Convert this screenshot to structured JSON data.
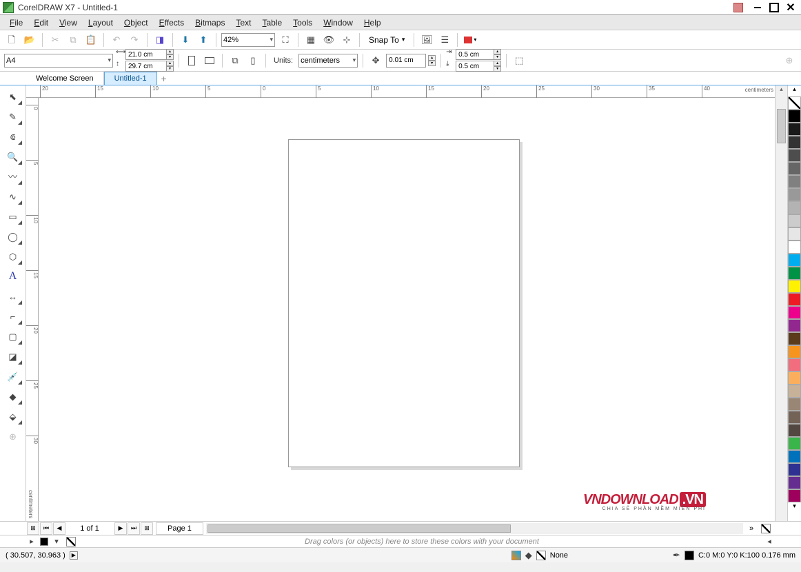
{
  "title": "CorelDRAW X7 - Untitled-1",
  "menu": [
    "File",
    "Edit",
    "View",
    "Layout",
    "Object",
    "Effects",
    "Bitmaps",
    "Text",
    "Table",
    "Tools",
    "Window",
    "Help"
  ],
  "zoom": "42%",
  "snap": "Snap To",
  "page_size": "A4",
  "dims": {
    "w": "21.0 cm",
    "h": "29.7 cm"
  },
  "units_label": "Units:",
  "units": "centimeters",
  "nudge": "0.01 cm",
  "dup": {
    "x": "0.5 cm",
    "y": "0.5 cm"
  },
  "tabs": [
    "Welcome Screen",
    "Untitled-1"
  ],
  "ruler_unit": "centimeters",
  "hruler_ticks": [
    -20,
    -15,
    -10,
    -5,
    0,
    5,
    10,
    15,
    20,
    25,
    30,
    35,
    40
  ],
  "vruler_ticks": [
    0,
    5,
    10,
    15,
    20,
    25,
    30
  ],
  "palette": [
    "#000000",
    "#1a1a1a",
    "#333333",
    "#4d4d4d",
    "#666666",
    "#808080",
    "#999999",
    "#b3b3b3",
    "#cccccc",
    "#e6e6e6",
    "#ffffff",
    "#00aeef",
    "#009245",
    "#fff200",
    "#ed1c24",
    "#ec008c",
    "#92278f",
    "#5a3b1c",
    "#f7941d",
    "#f26d7d",
    "#fbaf5d",
    "#c7b299",
    "#998675",
    "#736357",
    "#534741",
    "#39b54a",
    "#0072bc",
    "#2e3192",
    "#662d91",
    "#9e005d"
  ],
  "page_nav": {
    "current": "1 of 1",
    "tab": "Page 1"
  },
  "colorbar_hint": "Drag colors (or objects) here to store these colors with your document",
  "status": {
    "coords": "( 30.507, 30.963 )",
    "fill": "None",
    "outline": "C:0 M:0 Y:0 K:100  0.176 mm"
  },
  "watermark": {
    "main": "VNDOWNLOAD",
    "badge": ".VN",
    "sub": "CHIA SẺ PHẦN MỀM MIỄN PHÍ"
  }
}
